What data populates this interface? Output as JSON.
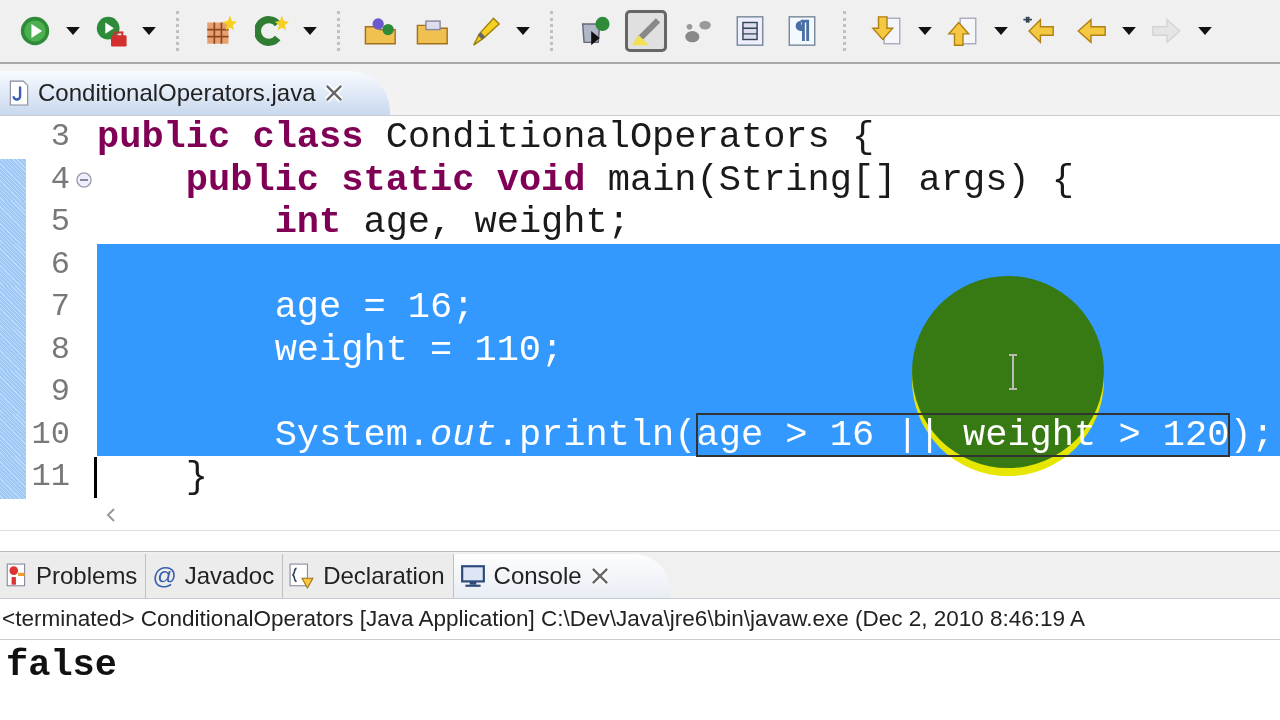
{
  "toolbar": [
    {
      "kind": "run",
      "pressed": false,
      "disabled": false
    },
    {
      "kind": "dropdown",
      "disabled": false
    },
    {
      "kind": "run_tool",
      "pressed": false,
      "disabled": false
    },
    {
      "kind": "dropdown",
      "disabled": false
    },
    {
      "kind": "separator"
    },
    {
      "kind": "new_grid",
      "pressed": false,
      "disabled": false
    },
    {
      "kind": "new_class",
      "pressed": false,
      "disabled": false
    },
    {
      "kind": "dropdown",
      "disabled": false
    },
    {
      "kind": "separator"
    },
    {
      "kind": "open_type",
      "pressed": false,
      "disabled": false
    },
    {
      "kind": "open_folder",
      "pressed": false,
      "disabled": false
    },
    {
      "kind": "pen",
      "pressed": false,
      "disabled": false
    },
    {
      "kind": "dropdown",
      "disabled": false
    },
    {
      "kind": "separator"
    },
    {
      "kind": "bin",
      "pressed": false,
      "disabled": false
    },
    {
      "kind": "highlighter",
      "pressed": true,
      "disabled": false
    },
    {
      "kind": "footprints",
      "pressed": false,
      "disabled": false
    },
    {
      "kind": "document",
      "pressed": false,
      "disabled": false
    },
    {
      "kind": "pilcrow",
      "pressed": false,
      "disabled": false
    },
    {
      "kind": "separator"
    },
    {
      "kind": "next_annotation",
      "pressed": false,
      "disabled": false
    },
    {
      "kind": "dropdown",
      "disabled": false
    },
    {
      "kind": "prev_annotation",
      "pressed": false,
      "disabled": false
    },
    {
      "kind": "dropdown",
      "disabled": false
    },
    {
      "kind": "last_edit",
      "pressed": false,
      "disabled": false
    },
    {
      "kind": "back",
      "pressed": false,
      "disabled": false
    },
    {
      "kind": "dropdown",
      "disabled": false
    },
    {
      "kind": "forward",
      "pressed": false,
      "disabled": true
    },
    {
      "kind": "dropdown",
      "disabled": false
    }
  ],
  "editor_tabs": [
    {
      "label": "ConditionalOperators.java",
      "selected": true
    }
  ],
  "editor": {
    "lines": [
      {
        "number": "3",
        "changed": false,
        "selected": false,
        "tokens": [
          {
            "kind": "keyword",
            "text": "public "
          },
          {
            "kind": "keyword",
            "text": "class "
          },
          {
            "kind": "plain",
            "text": "ConditionalOperators {"
          }
        ]
      },
      {
        "number": "4",
        "changed": true,
        "selected": false,
        "fold_expanded": true,
        "tokens": [
          {
            "kind": "keyword",
            "text": "    public "
          },
          {
            "kind": "keyword",
            "text": "static "
          },
          {
            "kind": "keyword",
            "text": "void "
          },
          {
            "kind": "plain",
            "text": "main(String[] args) {"
          }
        ]
      },
      {
        "number": "5",
        "changed": true,
        "selected": false,
        "tokens": [
          {
            "kind": "keyword",
            "text": "        int"
          },
          {
            "kind": "plain",
            "text": " age, weight;"
          }
        ]
      },
      {
        "number": "6",
        "changed": true,
        "selected": true
      },
      {
        "number": "7",
        "changed": true,
        "selected": true,
        "tokens": [
          {
            "kind": "plain",
            "text": "        age = 16;"
          }
        ]
      },
      {
        "number": "8",
        "changed": true,
        "selected": true,
        "tokens": [
          {
            "kind": "plain",
            "text": "        weight = 110;"
          }
        ]
      },
      {
        "number": "9",
        "changed": true,
        "selected": true
      },
      {
        "number": "10",
        "changed": true,
        "selected": true,
        "tokens": [
          {
            "kind": "plain",
            "text": "        System."
          },
          {
            "kind": "field",
            "text": "out"
          },
          {
            "kind": "plain",
            "text": ".println("
          },
          {
            "kind": "boxed",
            "text": "age > 16 || weight > 120"
          },
          {
            "kind": "plain",
            "text": ");"
          }
        ]
      },
      {
        "number": "11",
        "changed": true,
        "selected": false,
        "caret": true,
        "tokens": [
          {
            "kind": "plain",
            "text": "    }"
          }
        ]
      }
    ]
  },
  "panel_tabs": [
    {
      "kind": "problems",
      "label": "Problems",
      "selected": false
    },
    {
      "kind": "javadoc",
      "icon_text": "@",
      "label": "Javadoc",
      "selected": false
    },
    {
      "kind": "declaration",
      "label": "Declaration",
      "selected": false
    },
    {
      "kind": "console",
      "label": "Console",
      "selected": true
    }
  ],
  "console": {
    "header": "<terminated> ConditionalOperators [Java Application] C:\\Dev\\Java\\jre6\\bin\\javaw.exe (Dec 2, 2010 8:46:19 A",
    "output": "false"
  }
}
